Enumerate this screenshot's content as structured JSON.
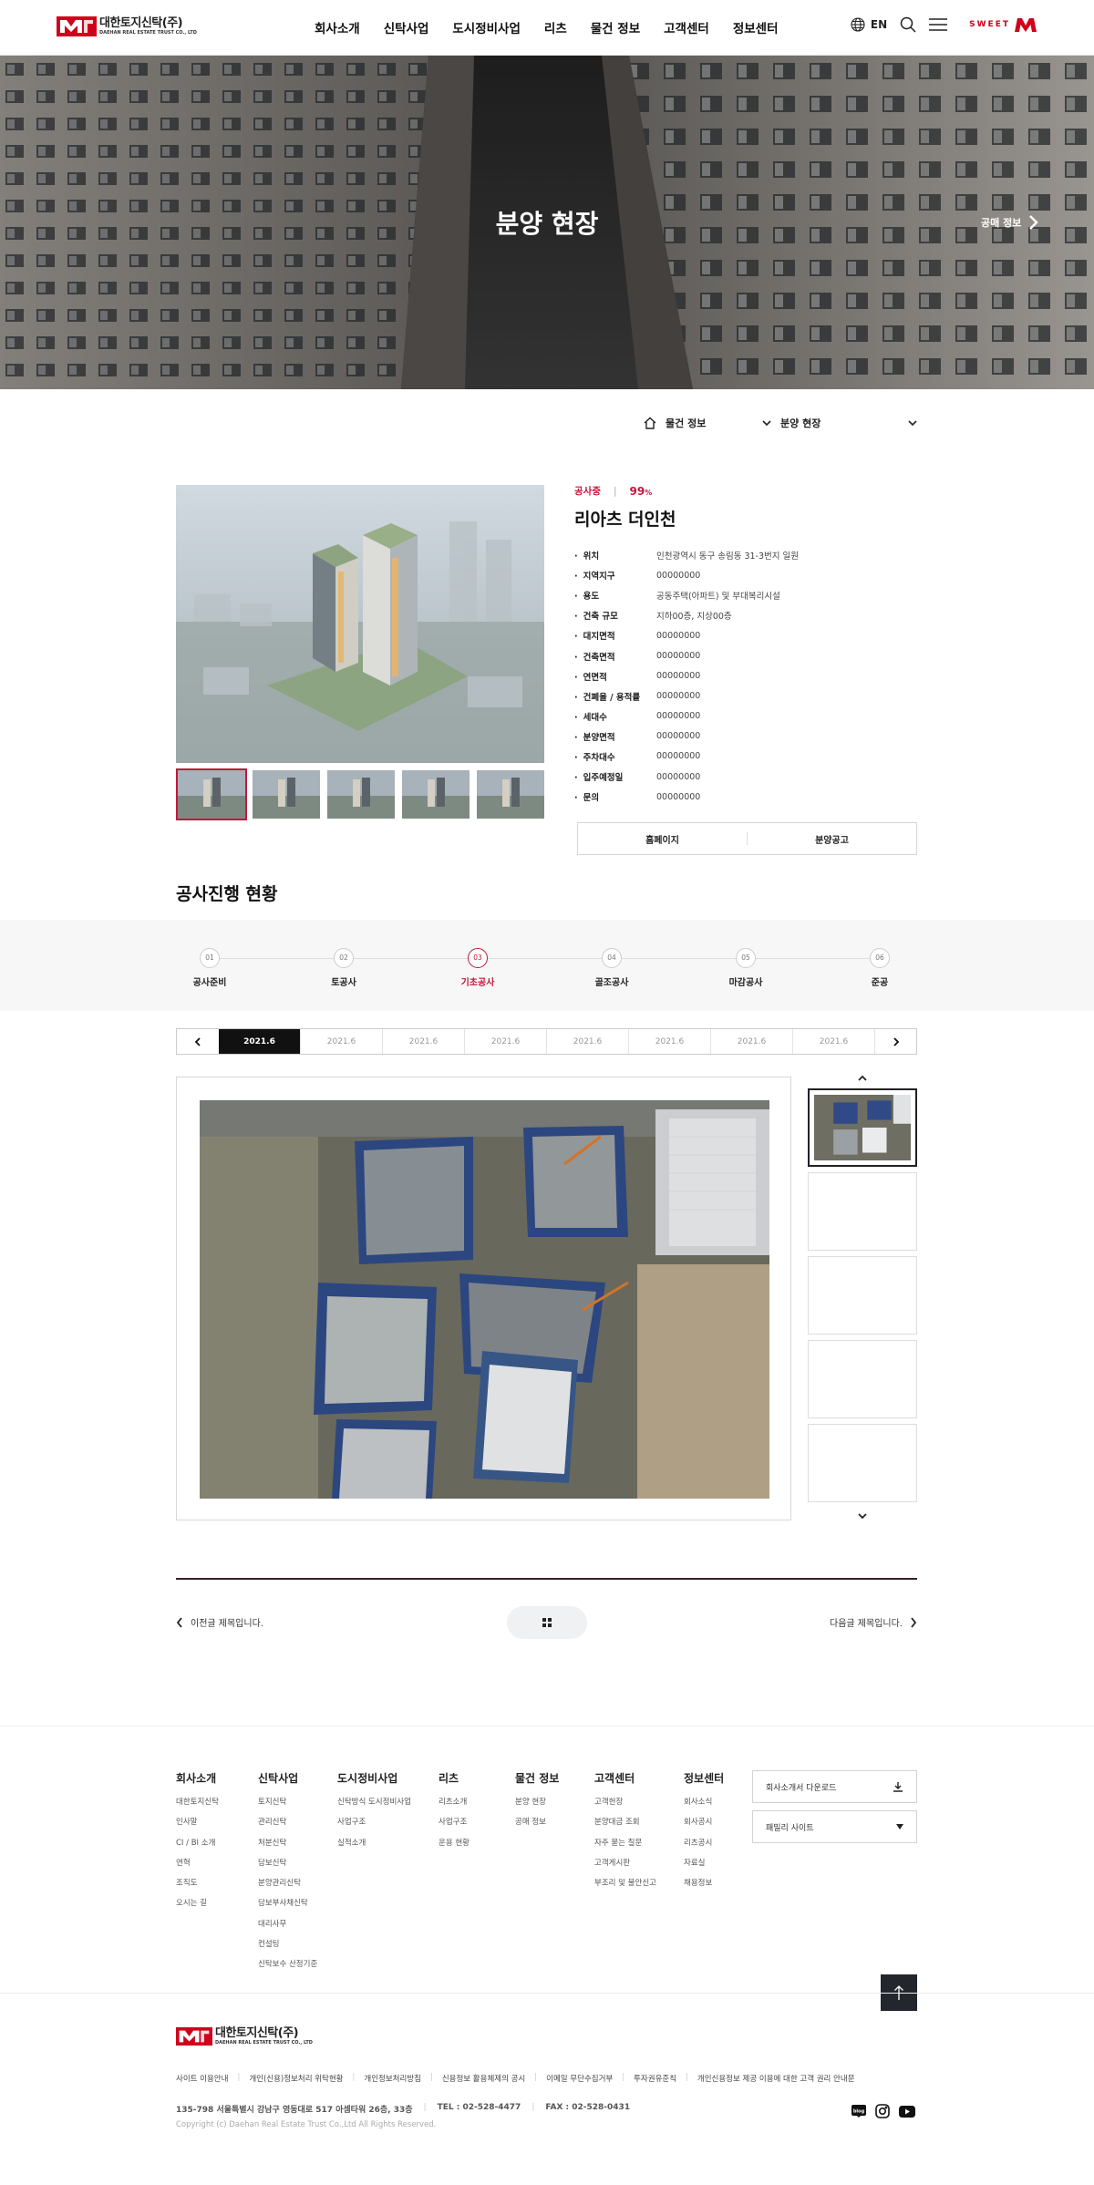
{
  "header": {
    "logo_ko": "대한토지신탁(주)",
    "logo_en": "DAEHAN REAL ESTATE TRUST CO., LTD",
    "nav": [
      "회사소개",
      "신탁사업",
      "도시정비사업",
      "리츠",
      "물건 정보",
      "고객센터",
      "정보센터"
    ],
    "lang": "EN",
    "sweet": "SWEET"
  },
  "hero": {
    "title": "분양 현장",
    "link": "공매 정보"
  },
  "breadcrumb": {
    "home": "물건 정보",
    "current": "분양 현장"
  },
  "project": {
    "status": "공사중",
    "percent": "99",
    "percent_unit": "%",
    "progress": 0.99,
    "title": "리아츠 더인천",
    "specs": [
      {
        "k": "위치",
        "v": "인천광역시 동구 송림동 31-3번지 일원"
      },
      {
        "k": "지역지구",
        "v": "00000000"
      },
      {
        "k": "용도",
        "v": "공동주택(아파트) 및 부대복리시설"
      },
      {
        "k": "건축 규모",
        "v": "지하00층, 지상00층"
      },
      {
        "k": "대지면적",
        "v": "00000000"
      },
      {
        "k": "건축면적",
        "v": "00000000"
      },
      {
        "k": "연면적",
        "v": "00000000"
      },
      {
        "k": "건폐율 / 용적률",
        "v": "00000000"
      },
      {
        "k": "세대수",
        "v": "00000000"
      },
      {
        "k": "분양면적",
        "v": "00000000"
      },
      {
        "k": "주차대수",
        "v": "00000000"
      },
      {
        "k": "입주예정일",
        "v": "00000000"
      },
      {
        "k": "문의",
        "v": "00000000"
      }
    ],
    "btn_home": "홈페이지",
    "btn_notice": "분양공고"
  },
  "progress_section": {
    "title": "공사진행 현황",
    "steps": [
      {
        "n": "01",
        "label": "공사준비"
      },
      {
        "n": "02",
        "label": "토공사"
      },
      {
        "n": "03",
        "label": "기초공사"
      },
      {
        "n": "04",
        "label": "골조공사"
      },
      {
        "n": "05",
        "label": "마감공사"
      },
      {
        "n": "06",
        "label": "준공"
      }
    ],
    "active_step": 2,
    "dates": [
      "2021.6",
      "2021.6",
      "2021.6",
      "2021.6",
      "2021.6",
      "2021.6",
      "2021.6",
      "2021.6"
    ],
    "active_date": 0
  },
  "pager": {
    "prev": "이전글 제목입니다.",
    "next": "다음글 제목입니다."
  },
  "footer": {
    "cols": [
      {
        "title": "회사소개",
        "items": [
          "대한토지신탁",
          "인사말",
          "CI / BI 소개",
          "연혁",
          "조직도",
          "오시는 길"
        ]
      },
      {
        "title": "신탁사업",
        "items": [
          "토지신탁",
          "관리신탁",
          "처분신탁",
          "담보신탁",
          "분양관리신탁",
          "담보부사채신탁",
          "대리사무",
          "컨설팅",
          "신탁보수 산정기준"
        ]
      },
      {
        "title": "도시정비사업",
        "items": [
          "신탁방식 도시정비사업",
          "사업구조",
          "실적소개"
        ]
      },
      {
        "title": "리츠",
        "items": [
          "리츠소개",
          "사업구조",
          "운용 현황"
        ]
      },
      {
        "title": "물건 정보",
        "items": [
          "분양 현장",
          "공매 정보"
        ]
      },
      {
        "title": "고객센터",
        "items": [
          "고객헌장",
          "분양대금 조회",
          "자주 묻는 질문",
          "고객게시판",
          "부조리 및 불안신고"
        ]
      },
      {
        "title": "정보센터",
        "items": [
          "회사소식",
          "회사공시",
          "리츠공시",
          "자료실",
          "채용정보"
        ]
      }
    ],
    "download": "회사소개서 다운로드",
    "family": "패밀리 사이트",
    "links": [
      "사이트 이용안내",
      "개인(신용)정보처리 위탁현황",
      "개인정보처리방침",
      "신용정보 활용체제의 공시",
      "이메일 무단수집거부",
      "투자권유준칙",
      "개인신용정보 제공 이용에 대한 고객 권리 안내문"
    ],
    "address": "135-798 서울특별시 강남구 영동대로 517 아셈타워 26층, 33층",
    "tel": "TEL : 02-528-4477",
    "fax": "FAX : 02-528-0431",
    "copyright": "Copyright (c) Daehan Real Estate Trust Co.,Ltd All Rights Reserved.",
    "sns": [
      "blog-icon",
      "instagram-icon",
      "youtube-icon"
    ]
  },
  "colors": {
    "accent": "#c4173a",
    "brand_red": "#d0021b",
    "dark": "#23272d"
  }
}
